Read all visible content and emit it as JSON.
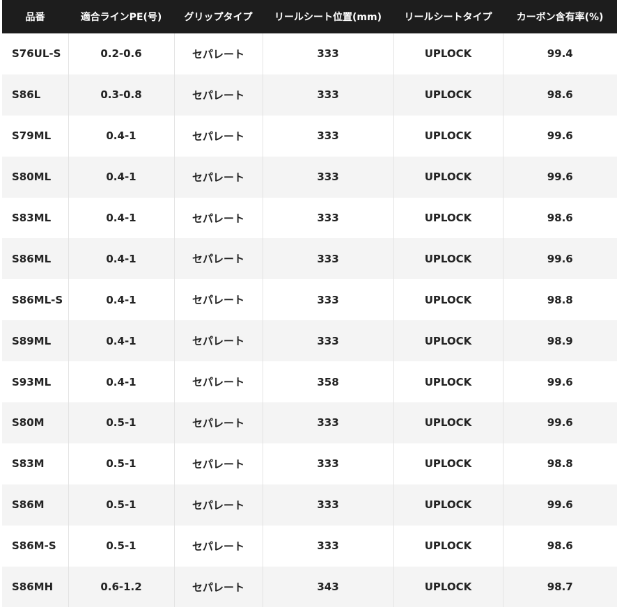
{
  "table": {
    "headers": [
      "品番",
      "適合ラインPE(号)",
      "グリップタイプ",
      "リールシート位置(mm)",
      "リールシートタイプ",
      "カーボン含有率(%)"
    ],
    "rows": [
      [
        "S76UL-S",
        "0.2-0.6",
        "セパレート",
        "333",
        "UPLOCK",
        "99.4"
      ],
      [
        "S86L",
        "0.3-0.8",
        "セパレート",
        "333",
        "UPLOCK",
        "98.6"
      ],
      [
        "S79ML",
        "0.4-1",
        "セパレート",
        "333",
        "UPLOCK",
        "99.6"
      ],
      [
        "S80ML",
        "0.4-1",
        "セパレート",
        "333",
        "UPLOCK",
        "99.6"
      ],
      [
        "S83ML",
        "0.4-1",
        "セパレート",
        "333",
        "UPLOCK",
        "98.6"
      ],
      [
        "S86ML",
        "0.4-1",
        "セパレート",
        "333",
        "UPLOCK",
        "99.6"
      ],
      [
        "S86ML-S",
        "0.4-1",
        "セパレート",
        "333",
        "UPLOCK",
        "98.8"
      ],
      [
        "S89ML",
        "0.4-1",
        "セパレート",
        "333",
        "UPLOCK",
        "98.9"
      ],
      [
        "S93ML",
        "0.4-1",
        "セパレート",
        "358",
        "UPLOCK",
        "99.6"
      ],
      [
        "S80M",
        "0.5-1",
        "セパレート",
        "333",
        "UPLOCK",
        "99.6"
      ],
      [
        "S83M",
        "0.5-1",
        "セパレート",
        "333",
        "UPLOCK",
        "98.8"
      ],
      [
        "S86M",
        "0.5-1",
        "セパレート",
        "333",
        "UPLOCK",
        "99.6"
      ],
      [
        "S86M-S",
        "0.5-1",
        "セパレート",
        "333",
        "UPLOCK",
        "98.6"
      ],
      [
        "S86MH",
        "0.6-1.2",
        "セパレート",
        "343",
        "UPLOCK",
        "98.7"
      ]
    ]
  },
  "colors": {
    "header_background": "#1d1d1d",
    "header_text": "#ffffff",
    "row_stripe": "#f4f4f4",
    "cell_text": "#222222"
  }
}
